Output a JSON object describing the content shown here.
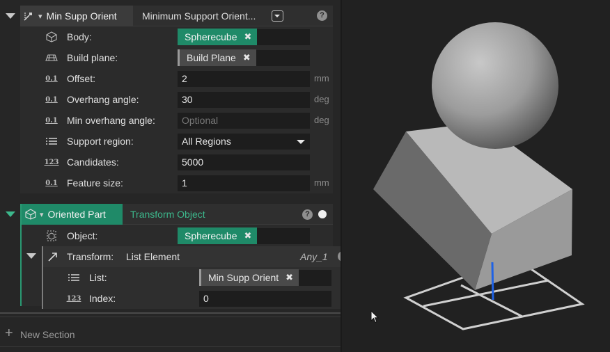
{
  "node1": {
    "tag_name": "Min Supp Orient",
    "operation": "Minimum Support Orient...",
    "help": "?",
    "params": {
      "body": {
        "label": "Body:",
        "value": "Spherecube"
      },
      "build_plane": {
        "label": "Build plane:",
        "value": "Build Plane"
      },
      "offset": {
        "label": "Offset:",
        "value": "2",
        "unit": "mm"
      },
      "overhang_angle": {
        "label": "Overhang angle:",
        "value": "30",
        "unit": "deg"
      },
      "min_overhang_angle": {
        "label": "Min overhang angle:",
        "placeholder": "Optional",
        "unit": "deg"
      },
      "support_region": {
        "label": "Support region:",
        "value": "All Regions"
      },
      "candidates": {
        "label": "Candidates:",
        "value": "5000"
      },
      "feature_size": {
        "label": "Feature size:",
        "value": "1",
        "unit": "mm"
      }
    }
  },
  "node2": {
    "tag_name": "Oriented Part",
    "operation": "Transform Object",
    "help": "?",
    "params": {
      "object": {
        "label": "Object:",
        "value": "Spherecube"
      },
      "transform": {
        "label": "Transform:",
        "operation": "List Element",
        "type_hint": "Any_1",
        "help": "?"
      },
      "list": {
        "label": "List:",
        "value": "Min Supp Orient"
      },
      "index": {
        "label": "Index:",
        "value": "0"
      }
    }
  },
  "footer": {
    "new_section": "New Section"
  },
  "icons": {
    "collapse": "triangle-down-icon",
    "node": "orient-node-icon",
    "body": "body-icon",
    "plane": "plane-icon",
    "number": "decimal-0.1-icon",
    "list": "list-icon",
    "integer": "integer-123-icon",
    "chip_remove": "close-x-icon",
    "plus": "plus-icon"
  },
  "colors": {
    "accent_green": "#1f8a68",
    "operation_green": "#3cb88c",
    "blue_axis": "#1e62e6"
  }
}
